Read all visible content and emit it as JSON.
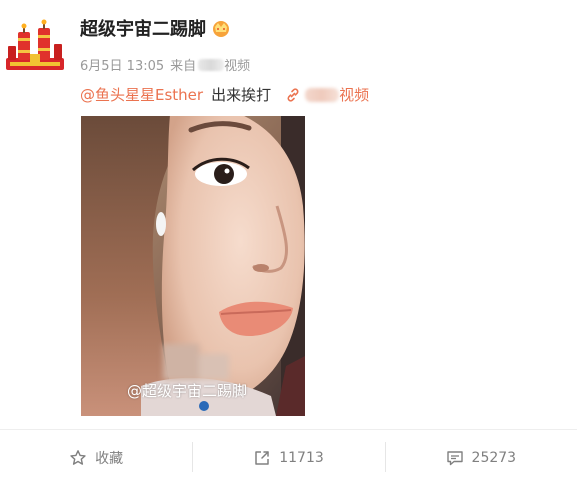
{
  "post": {
    "author": "超级宇宙二踢脚",
    "date": "6月5日 13:05",
    "source_prefix": "来自",
    "source_suffix": "视频",
    "mention": "@鱼头星星Esther",
    "text": "出来挨打",
    "link_suffix": "视频"
  },
  "video": {
    "watermark": "@超级宇宙二踢脚"
  },
  "actions": {
    "favorite_label": "收藏",
    "repost_count": "11713",
    "comment_count": "25273"
  },
  "colors": {
    "accent": "#eb7350",
    "meta": "#999999",
    "action": "#808080"
  }
}
